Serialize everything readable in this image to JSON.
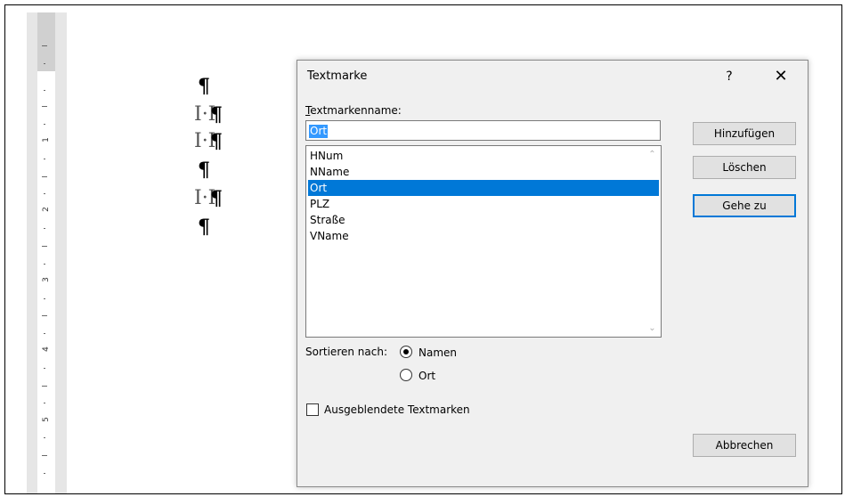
{
  "ruler": {
    "numbers": [
      "1",
      "2",
      "3",
      "4",
      "5"
    ]
  },
  "document": {
    "pilcrow": "¶",
    "bookmark_mark": "I·I"
  },
  "dialog": {
    "title": "Textmarke",
    "help_symbol": "?",
    "close_symbol": "✕",
    "name_label": "Textmarkenname:",
    "name_label_accesskey": "T",
    "name_value": "Ort",
    "bookmarks": [
      "HNum",
      "NName",
      "Ort",
      "PLZ",
      "Straße",
      "VName"
    ],
    "selected_bookmark": "Ort",
    "scroll_up_icon": "chevron-up-icon",
    "scroll_down_icon": "chevron-down-icon",
    "buttons": {
      "add": "Hinzufügen",
      "delete": "Löschen",
      "goto": "Gehe zu",
      "cancel": "Abbrechen"
    },
    "sort_label": "Sortieren nach:",
    "sort_options": {
      "name": "Namen",
      "location": "Ort"
    },
    "sort_selected": "Namen",
    "hidden_bookmarks_label": "Ausgeblendete Textmarken",
    "hidden_bookmarks_checked": false
  }
}
